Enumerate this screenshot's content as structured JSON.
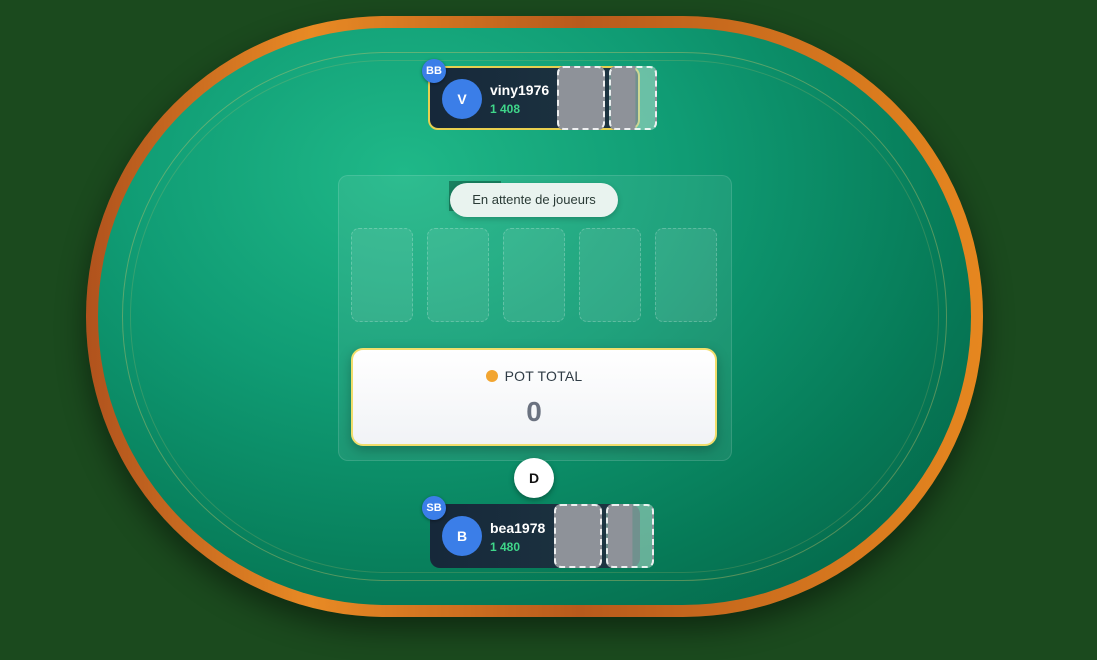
{
  "table": {
    "status": "En attente de joueurs",
    "community_card_slots": 5,
    "pot": {
      "label": "POT TOTAL",
      "amount": "0"
    },
    "dealer_button": "D"
  },
  "players": {
    "top": {
      "initial": "V",
      "name": "viny1976",
      "stack": "1 408",
      "role": "BB"
    },
    "bottom": {
      "initial": "B",
      "name": "bea1978",
      "stack": "1 480",
      "role": "SB"
    }
  },
  "colors": {
    "felt": "#109c74",
    "rim": "#e88a24",
    "accent_blue": "#3b7ee8",
    "stack_green": "#3fd68a",
    "pot_dot": "#f2a531",
    "highlight_border": "#e8d050"
  }
}
